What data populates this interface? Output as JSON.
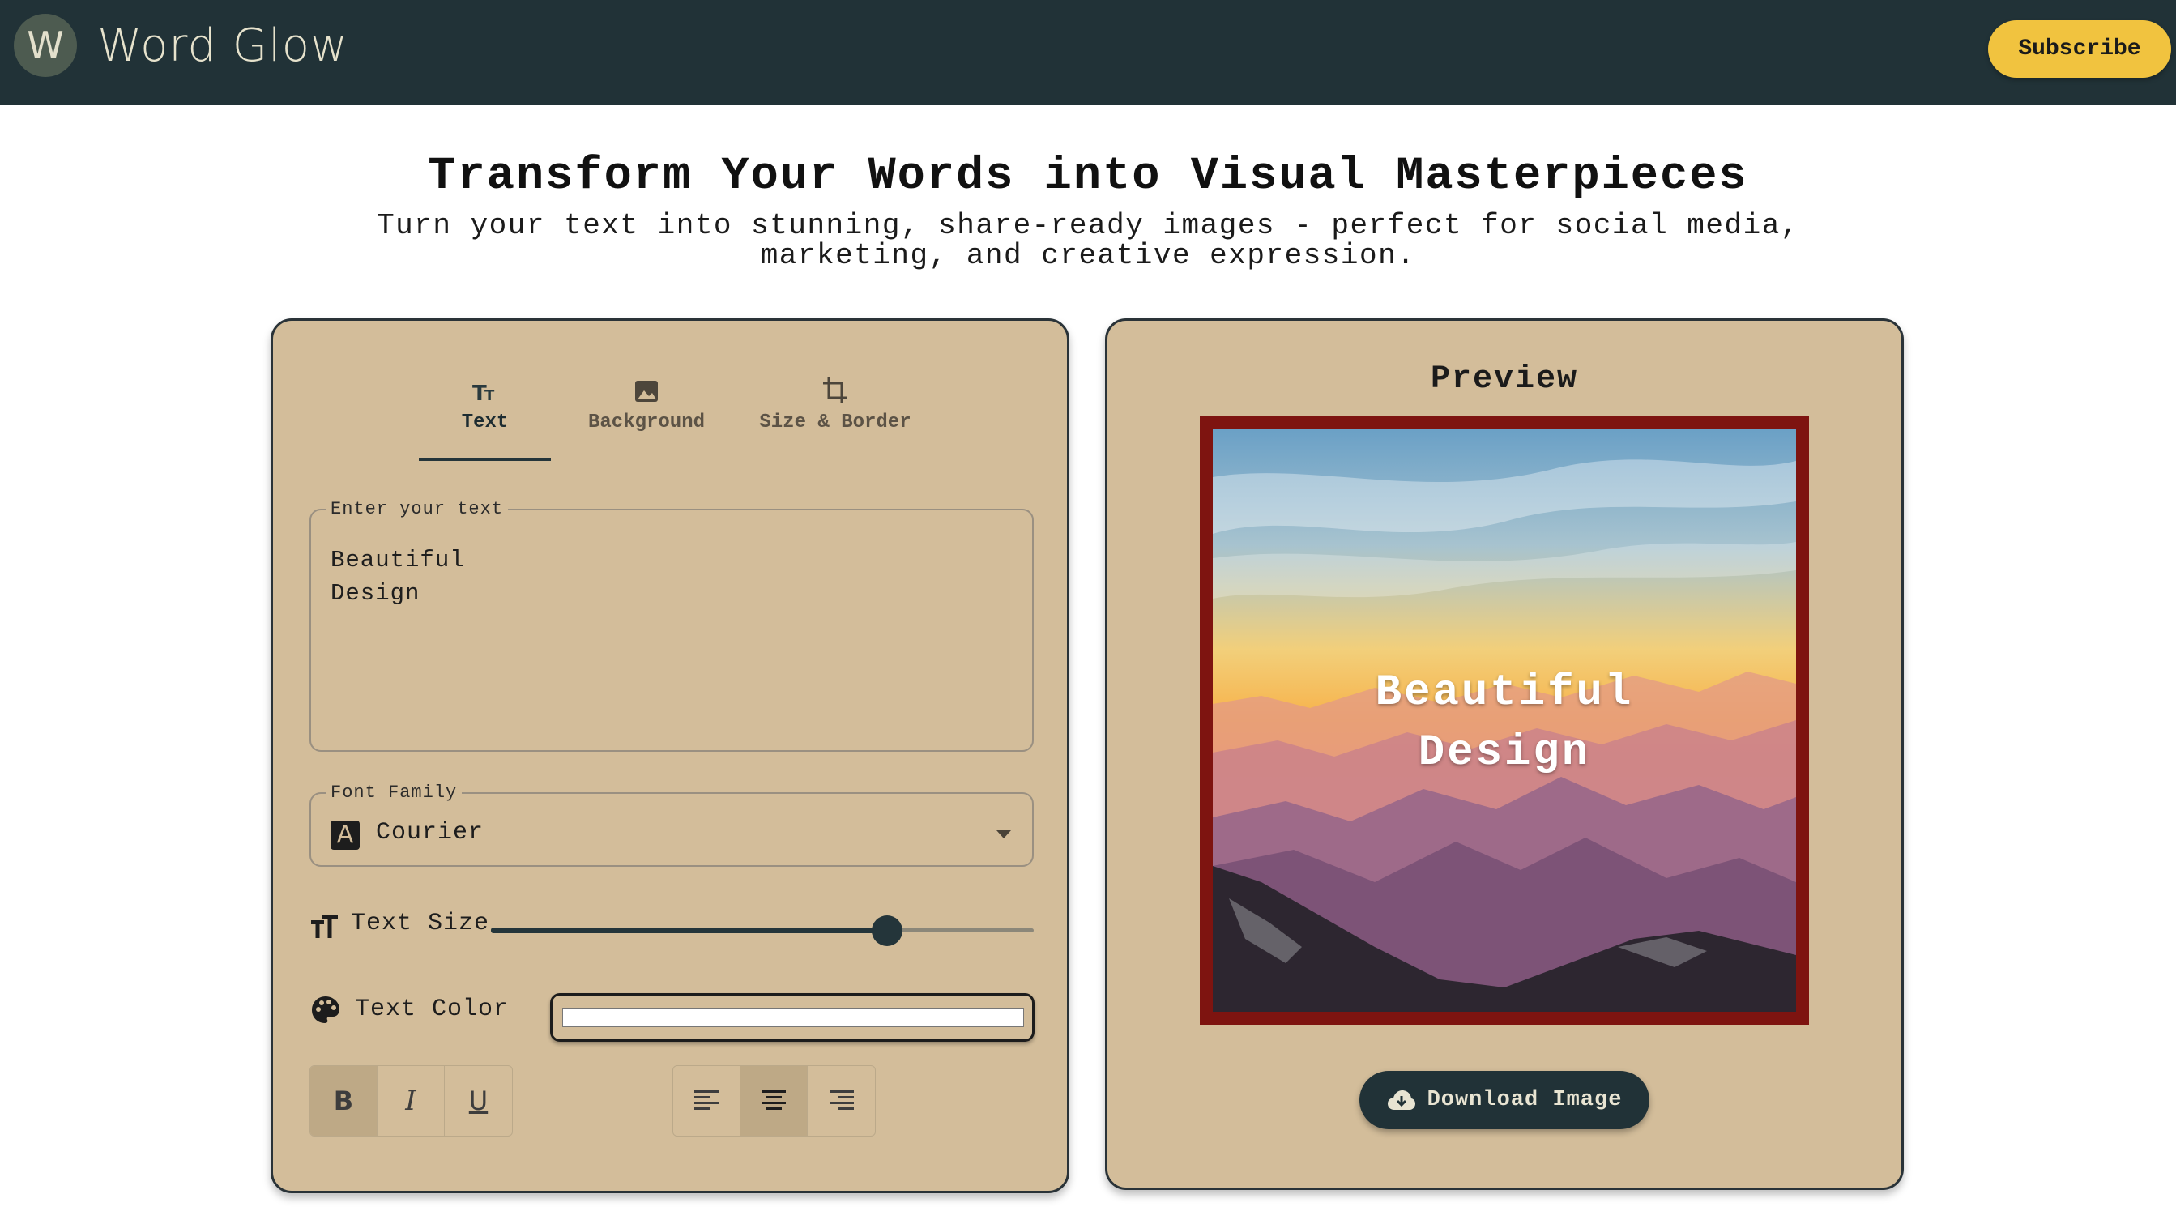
{
  "header": {
    "logo_letter": "W",
    "brand": "Word Glow",
    "subscribe_label": "Subscribe"
  },
  "hero": {
    "title": "Transform Your Words into Visual Masterpieces",
    "subtitle": "Turn your text into stunning, share-ready images - perfect for social media, marketing, and creative expression."
  },
  "editor": {
    "tabs": [
      {
        "label": "Text",
        "icon": "text-fields-icon",
        "active": true
      },
      {
        "label": "Background",
        "icon": "image-icon",
        "active": false
      },
      {
        "label": "Size & Border",
        "icon": "crop-icon",
        "active": false
      }
    ],
    "text_field": {
      "label": "Enter your text",
      "value": "Beautiful\nDesign"
    },
    "font_field": {
      "label": "Font Family",
      "badge": "A",
      "value": "Courier"
    },
    "text_size": {
      "label": "Text Size",
      "level": 0.73
    },
    "text_color": {
      "label": "Text Color",
      "value": "#ffffff"
    },
    "style_buttons": [
      {
        "name": "bold",
        "glyph": "B",
        "active": true
      },
      {
        "name": "italic",
        "glyph": "I",
        "active": false
      },
      {
        "name": "underline",
        "glyph": "U",
        "active": false
      }
    ],
    "align_buttons": [
      {
        "name": "align-left",
        "active": false
      },
      {
        "name": "align-center",
        "active": true
      },
      {
        "name": "align-right",
        "active": false
      }
    ]
  },
  "preview": {
    "title": "Preview",
    "text": "Beautiful\nDesign",
    "border_color": "#7e1410",
    "download_label": "Download Image"
  },
  "colors": {
    "topbar": "#213237",
    "panel": "#d3bd9a",
    "accent": "#f1c33f"
  }
}
